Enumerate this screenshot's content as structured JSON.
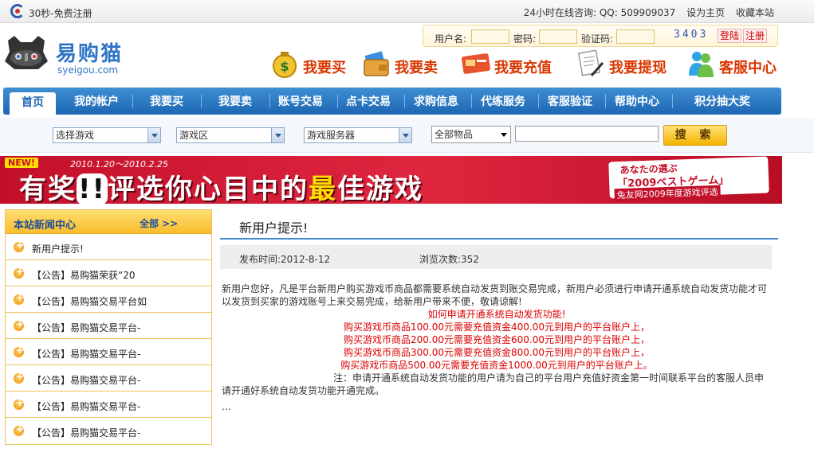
{
  "topbar": {
    "register_text": "30秒-免费注册",
    "hotline": "24小时在线咨询: QQ: 509909037",
    "set_home": "设为主页",
    "bookmark": "收藏本站"
  },
  "brand": {
    "name": "易购猫",
    "domain": "syeigou.com"
  },
  "login": {
    "username_label": "用户名:",
    "password_label": "密码:",
    "captcha_label": "验证码:",
    "captcha_code": "3403",
    "login_button": "登陆",
    "register_button": "注册"
  },
  "quicknav": [
    {
      "label": "我要买",
      "icon": "money-bag-icon"
    },
    {
      "label": "我要卖",
      "icon": "wallet-card-icon"
    },
    {
      "label": "我要充值",
      "icon": "credit-card-icon"
    },
    {
      "label": "我要提现",
      "icon": "document-pen-icon"
    },
    {
      "label": "客服中心",
      "icon": "messenger-icon"
    }
  ],
  "nav": [
    "首页",
    "我的帐户",
    "我要买",
    "我要卖",
    "账号交易",
    "点卡交易",
    "求购信息",
    "代练服务",
    "客服验证",
    "帮助中心",
    "积分抽大奖"
  ],
  "search": {
    "game": "选择游戏",
    "zone": "游戏区",
    "server": "游戏服务器",
    "item_type": "全部物品",
    "keyword": "",
    "button": "搜 索"
  },
  "banner": {
    "badge": "NEW!",
    "date": "2010.1.20～2010.2.25",
    "title_prefix": "有奖",
    "title_marks": "!!",
    "title_middle": "评选你心目中的",
    "title_highlight": "最",
    "title_suffix": "佳游戏",
    "jp_line1": "あなたの選ぶ",
    "jp_line2": "「2009ベストゲーム」",
    "jp_line3": "兔友网2009年度游戏评选"
  },
  "sidebar": {
    "title": "本站新闻中心",
    "all_link": "全部 >>",
    "items": [
      "新用户提示!",
      "【公告】易购猫荣获“20",
      "【公告】易购猫交易平台如",
      "【公告】易购猫交易平台-",
      "【公告】易购猫交易平台-",
      "【公告】易购猫交易平台-",
      "【公告】易购猫交易平台-",
      "【公告】易购猫交易平台-"
    ]
  },
  "article": {
    "title": "新用户提示!",
    "publish_label": "发布时间:",
    "publish_date": "2012-8-12",
    "views_label": "浏览次数:",
    "views": "352",
    "intro": "新用户您好，凡是平台新用户购买游戏币商品都需要系统自动发货到账交易完成，新用户必须进行申请开通系统自动发货功能才可以发货到买家的游戏账号上来交易完成，给新用户带来不便，敬请谅解!",
    "how_title": "如何申请开通系统自动发货功能!",
    "rules": [
      "购买游戏币商品100.00元需要充值资金400.00元到用户的平台账户上，",
      "购买游戏币商品200.00元需要充值资金600.00元到用户的平台账户上，",
      "购买游戏币商品300.00元需要充值资金800.00元到用户的平台账户上，",
      "购买游戏币商品500.00元需要充值资金1000.00元到用户的平台账户上。"
    ],
    "note": "注：申请开通系统自动发货功能的用户请为自己的平台用户充值好资金第一时间联系平台的客服人员申请开通好系统自动发货功能开通完成。",
    "tail": "…"
  },
  "colors": {
    "nav_blue": "#1d66b2",
    "accent_orange": "#d93600",
    "banner_red": "#c3102a",
    "sidebar_gold": "#f9bd2b"
  }
}
